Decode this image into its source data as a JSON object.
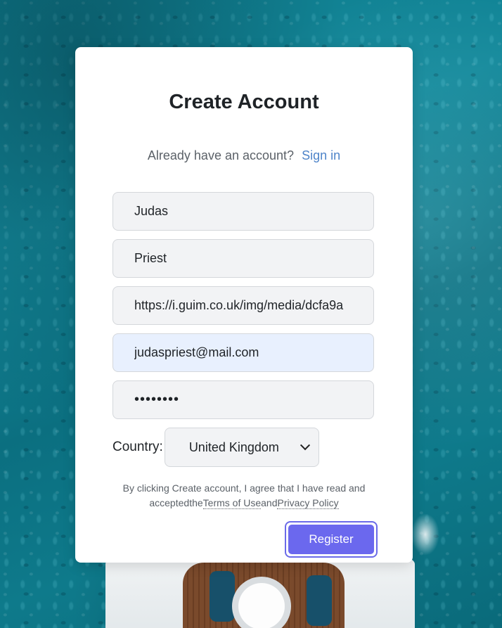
{
  "page": {
    "title": "Create Account",
    "signin_prompt": "Already have an account?",
    "signin_link": "Sign in"
  },
  "form": {
    "first_name": "Judas",
    "last_name": "Priest",
    "avatar_url": "https://i.guim.co.uk/img/media/dcfa9a",
    "email": "judaspriest@mail.com",
    "password_mask": "••••••••",
    "country_label": "Country:",
    "country_value": "United Kingdom"
  },
  "terms": {
    "prefix": "By clicking Create account, I agree that I have read and accepted",
    "the": "the",
    "terms_link": "Terms of Use",
    "and": "and",
    "privacy_link": "Privacy Policy"
  },
  "actions": {
    "register_label": "Register"
  },
  "colors": {
    "accent": "#6b68ee",
    "link": "#4e84c9",
    "autofill_bg": "#e8f0fe"
  }
}
